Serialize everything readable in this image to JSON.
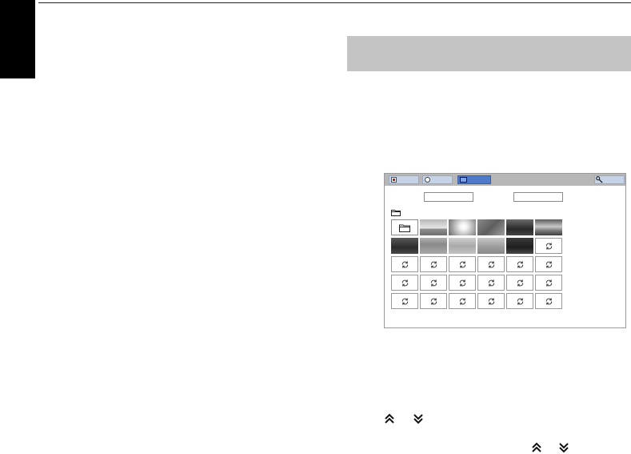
{
  "page": {
    "edge_tab_color": "#000000",
    "heading_bar_color": "#c4c4c4"
  },
  "media_ui": {
    "tabs": [
      {
        "id": "photo",
        "icon": "photo-icon",
        "selected": false
      },
      {
        "id": "music",
        "icon": "music-icon",
        "selected": false
      },
      {
        "id": "video",
        "icon": "video-icon",
        "selected": true
      },
      {
        "id": "setup",
        "icon": "wrench-icon",
        "selected": false
      }
    ],
    "accent_color": "#4f79c9",
    "left_field_value": "",
    "right_field_value": "",
    "grid": [
      [
        "folder",
        "photo",
        "photo",
        "photo",
        "photo",
        "photo"
      ],
      [
        "photo",
        "photo",
        "photo",
        "photo",
        "photo",
        "refresh"
      ],
      [
        "refresh",
        "refresh",
        "refresh",
        "refresh",
        "refresh",
        "refresh"
      ],
      [
        "refresh",
        "refresh",
        "refresh",
        "refresh",
        "refresh",
        "refresh"
      ],
      [
        "refresh",
        "refresh",
        "refresh",
        "refresh",
        "refresh",
        "refresh"
      ]
    ],
    "thumbnails": [
      {
        "tone": "sky-clouds"
      },
      {
        "tone": "sun-glare"
      },
      {
        "tone": "bare-tree"
      },
      {
        "tone": "dark-hills"
      },
      {
        "tone": "cloudy-sky"
      },
      {
        "tone": "dark-shore"
      },
      {
        "tone": "grassy-field"
      },
      {
        "tone": "grey-landscape"
      },
      {
        "tone": "hazy-horizon"
      },
      {
        "tone": "dark-trees"
      }
    ]
  },
  "nav_icons": [
    "chevron-double-up-icon",
    "chevron-double-down-icon"
  ]
}
